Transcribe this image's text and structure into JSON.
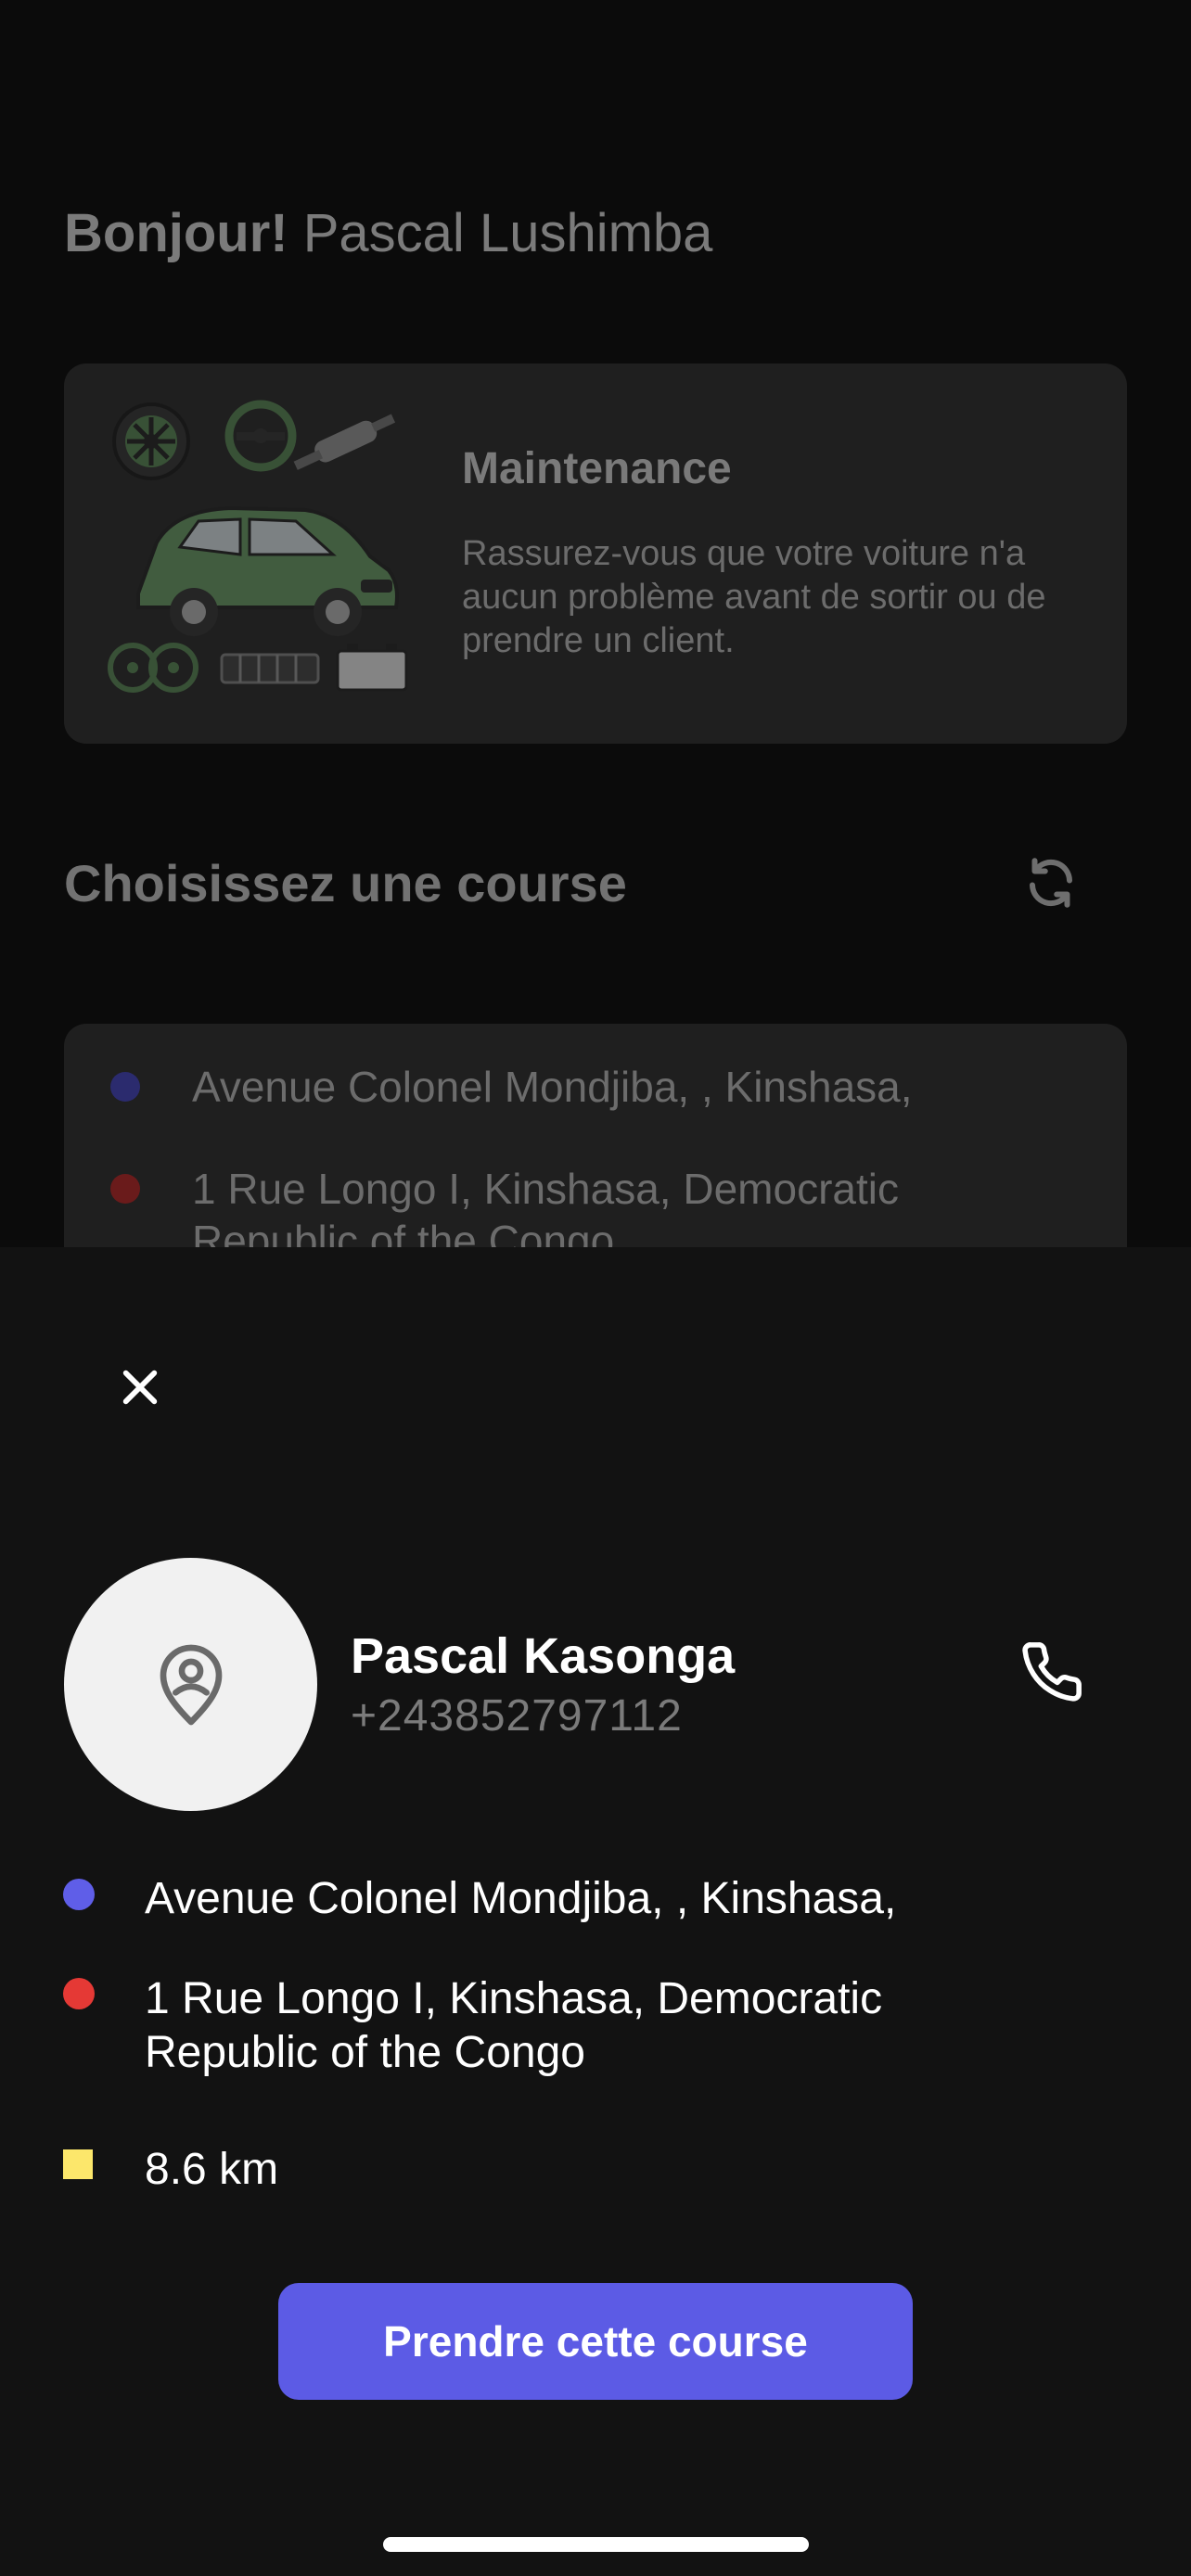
{
  "greeting": {
    "bold": "Bonjour!",
    "name": "Pascal Lushimba"
  },
  "maintenance": {
    "title": "Maintenance",
    "description": "Rassurez-vous que votre voiture n'a aucun problème avant de sortir ou de prendre un client.",
    "illustration_icon": "car-parts-illustration",
    "car_color": "#5e8f5a"
  },
  "courses": {
    "section_title": "Choisissez une course",
    "refresh_icon": "refresh-icon",
    "preview": {
      "pickup": "Avenue Colonel Mondjiba, , Kinshasa,",
      "dropoff": "1 Rue Longo I, Kinshasa, Democratic Republic of the Congo"
    }
  },
  "sheet": {
    "close_icon": "close-icon",
    "client": {
      "name": "Pascal Kasonga",
      "phone": "+243852797112",
      "avatar_icon": "user-pin-icon"
    },
    "call_icon": "phone-icon",
    "pickup": "Avenue Colonel Mondjiba, , Kinshasa,",
    "dropoff": "1 Rue Longo I, Kinshasa, Democratic Republic of the Congo",
    "distance": "8.6 km",
    "cta_label": "Prendre cette course"
  },
  "colors": {
    "accent": "#5c5be5",
    "pickup_dot": "#5f5ee8",
    "dropoff_dot": "#e53935",
    "distance_marker": "#fce76b"
  }
}
